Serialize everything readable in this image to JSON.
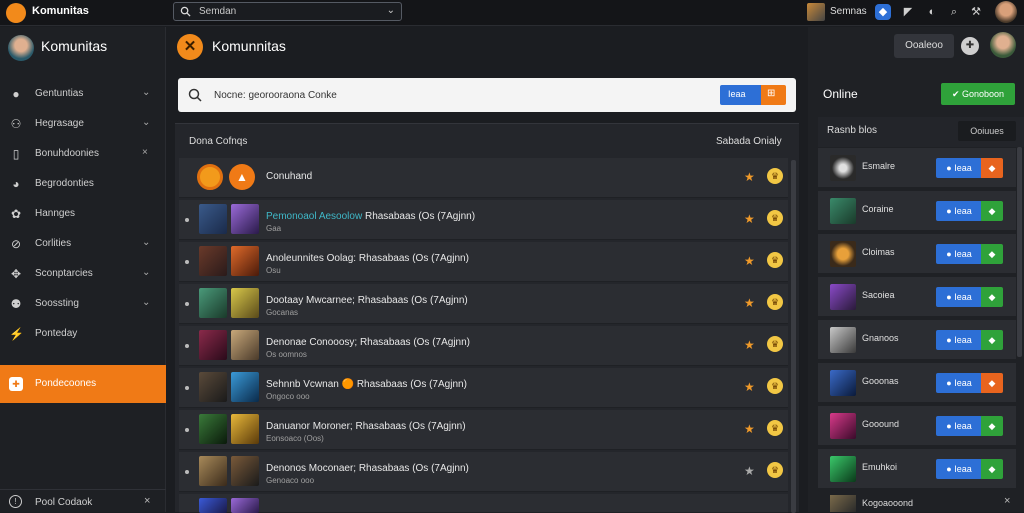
{
  "topbar": {
    "brand": "Komunitas",
    "search_value": "Semdan",
    "username": "Semnas",
    "icons": [
      "shield-icon",
      "bell-icon",
      "search-icon",
      "settings-icon"
    ]
  },
  "sidebar": {
    "profile_name": "Komunitas",
    "items": [
      {
        "label": "Gentuntias",
        "icon": "chat-icon",
        "control": "⌄"
      },
      {
        "label": "Hegrasage",
        "icon": "users-icon",
        "control": "⌄"
      },
      {
        "label": "Bonuhdoonies",
        "icon": "square-icon",
        "control": "×"
      },
      {
        "label": "Begrodonties",
        "icon": "message-icon",
        "control": ""
      },
      {
        "label": "Hannges",
        "icon": "puzzle-icon",
        "control": ""
      },
      {
        "label": "Corlities",
        "icon": "link-icon",
        "control": "⌄"
      },
      {
        "label": "Sconptarcies",
        "icon": "gamepad-icon",
        "control": "⌄"
      },
      {
        "label": "Soossting",
        "icon": "group-icon",
        "control": "⌄"
      },
      {
        "label": "Ponteday",
        "icon": "arrow-icon",
        "control": ""
      }
    ],
    "active_item": {
      "label": "Pondecoones"
    },
    "footer": {
      "label": "Pool Codaok",
      "close": "×"
    }
  },
  "main": {
    "title": "Komunnitas",
    "search_placeholder": "Nocne: georooraona Conke",
    "search_btn_label": "Ieaa",
    "list_header_left": "Dona Cofnqs",
    "list_header_right": "Sabada Onialy",
    "first_row": {
      "title": "Conuhand"
    },
    "rows": [
      {
        "title_hl": "Pemonoaol Aesoolow",
        "title": " Rhasabaas (Os (7Agjnn)",
        "sub": "Gaa",
        "star": "orange"
      },
      {
        "title_hl": "",
        "title": "Anoleunnites Oolag: Rhasabaas (Os (7Agjnn)",
        "sub": "Osu",
        "star": "orange"
      },
      {
        "title_hl": "",
        "title": "Dootaay Mwcarnee; Rhasabaas (Os (7Agjnn)",
        "sub": "Gocanas",
        "star": "orange"
      },
      {
        "title_hl": "",
        "title": "Denonae Conooosy; Rhasabaas (Os (7Agjnn)",
        "sub": "Os oomnos",
        "star": "orange"
      },
      {
        "title_hl": "",
        "title": "Sehnnb Vcwnan 🟠 Rhasabaas (Os (7Agjnn)",
        "sub": "Ongoco ooo",
        "star": "orange"
      },
      {
        "title_hl": "",
        "title": "Danuanor Moroner; Rhasabaas (Os (7Agjnn)",
        "sub": "Eonsoaco (Oos)",
        "star": "orange"
      },
      {
        "title_hl": "",
        "title": "Denonos Moconaer; Rhasabaas (Os (7Agjnn)",
        "sub": "Genoaco ooo",
        "star": "grey"
      }
    ]
  },
  "right": {
    "top_button": "Ooaleoo",
    "online_title": "Online",
    "online_button": "Gonoboon",
    "panel_header_left": "Rasnb blos",
    "panel_header_right": "Ooiuues",
    "friends": [
      {
        "name": "Esmalre",
        "btn": "Ieaa",
        "color": "orange"
      },
      {
        "name": "Coraine",
        "btn": "Ieaa",
        "color": "green"
      },
      {
        "name": "Cloimas",
        "btn": "Ieaa",
        "color": "green"
      },
      {
        "name": "Sacoiea",
        "btn": "Ieaa",
        "color": "green"
      },
      {
        "name": "Gnanoos",
        "btn": "Ieaa",
        "color": "green"
      },
      {
        "name": "Gooonas",
        "btn": "Ieaa",
        "color": "orange"
      },
      {
        "name": "Gooound",
        "btn": "Ieaa",
        "color": "green"
      },
      {
        "name": "Emuhkoi",
        "btn": "Ieaa",
        "color": "green"
      }
    ],
    "last_row": "Kogoaooond"
  }
}
